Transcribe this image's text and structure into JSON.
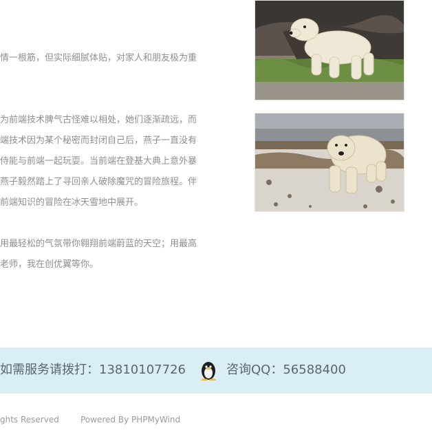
{
  "intro": {
    "paragraph_1": [
      "情一根筋，但实际细腻体贴，对家人和朋友极为重"
    ],
    "paragraph_2": [
      "为前端技术脾气古怪难以相处，她们逐渐疏远，而",
      "端技术因为某个秘密而封闭自己后，燕子一直没有",
      "侍能与前端一起玩耍。当前端在登基大典上意外暴",
      "燕子毅然踏上了寻回亲人破除魔咒的冒险旅程。伴",
      "前端知识的冒险在冰天雪地中展开。"
    ],
    "paragraph_3": [
      "用最轻松的气氛带你翱翔前端蔚蓝的天空；用最高",
      "老师，我在创优翼等你。"
    ]
  },
  "images": [
    {
      "icon": "polar-bear-walking-on-rocks"
    },
    {
      "icon": "polar-bear-on-snow"
    }
  ],
  "contact": {
    "phone_text": "如需服务请拨打：13810107726",
    "qq_text": "咨询QQ：56588400",
    "qq_icon": "penguin-icon"
  },
  "footer": {
    "rights": "ghts Reserved",
    "powered": "Powered By PHPMyWind"
  },
  "colors": {
    "band_bg": "#d9eef5",
    "body_text": "#8f8f8f"
  }
}
